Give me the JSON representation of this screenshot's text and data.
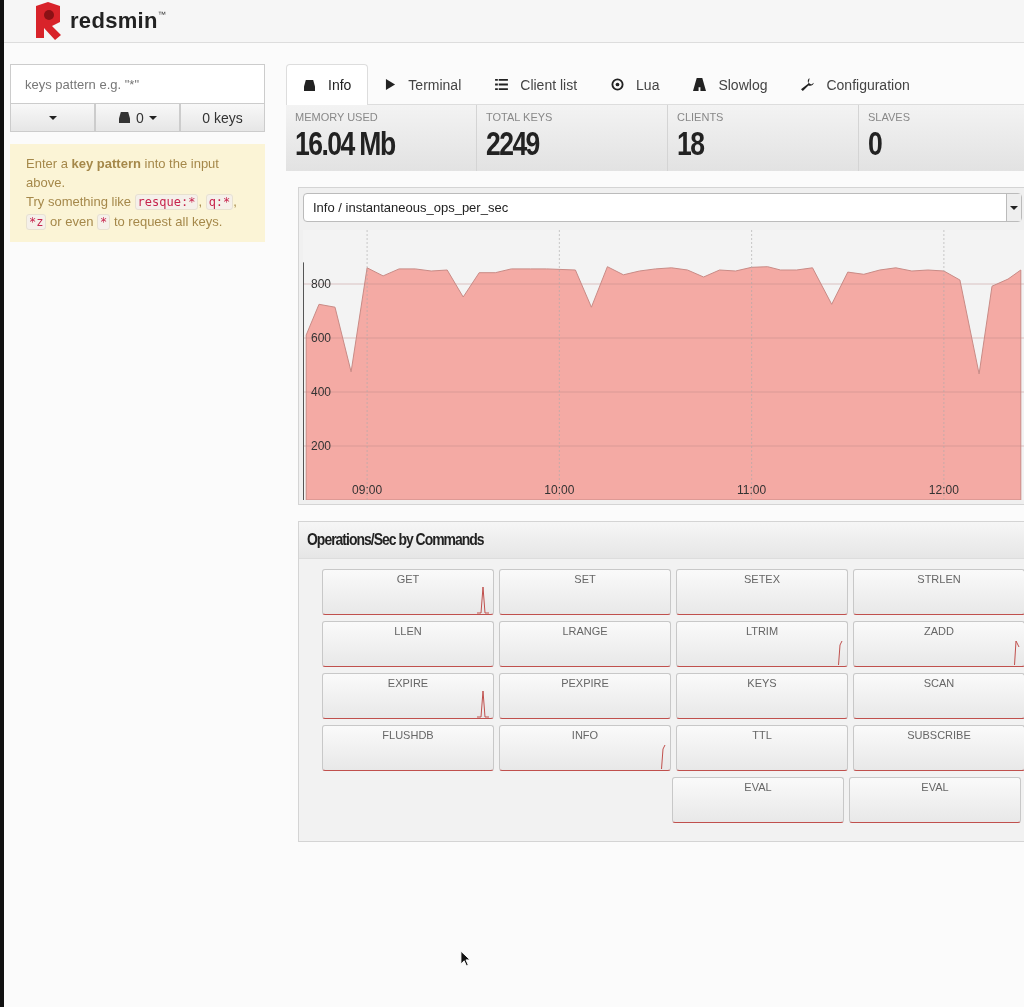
{
  "header": {
    "brand": "redsmin",
    "trademark": "™"
  },
  "sidebar": {
    "search": {
      "placeholder": "keys pattern e.g. \"*\""
    },
    "db_button": "0",
    "keys_count": "0 keys",
    "hint": {
      "intro": "Enter a **key pattern** into the input above.",
      "parts": [
        {
          "kind": "text",
          "text": "Try something like "
        },
        {
          "kind": "code",
          "text": "resque:*"
        },
        {
          "kind": "text",
          "text": ", "
        },
        {
          "kind": "code",
          "text": "q:*"
        },
        {
          "kind": "text",
          "text": ", "
        },
        {
          "kind": "code",
          "text": "*z"
        },
        {
          "kind": "text",
          "text": " or even "
        },
        {
          "kind": "code",
          "text": "*"
        },
        {
          "kind": "text",
          "text": " to request all keys."
        }
      ]
    }
  },
  "tabs": [
    {
      "label": "Info",
      "selected": true
    },
    {
      "label": "Terminal",
      "selected": false
    },
    {
      "label": "Client list",
      "selected": false
    },
    {
      "label": "Lua",
      "selected": false
    },
    {
      "label": "Slowlog",
      "selected": false
    },
    {
      "label": "Configuration",
      "selected": false
    }
  ],
  "stats": [
    {
      "label": "MEMORY USED",
      "value": "16.04 Mb"
    },
    {
      "label": "TOTAL KEYS",
      "value": "2249"
    },
    {
      "label": "CLIENTS",
      "value": "18"
    },
    {
      "label": "SLAVES",
      "value": "0"
    }
  ],
  "metric_select": {
    "value": "Info / instantaneous_ops_per_sec"
  },
  "chart_data": {
    "type": "area",
    "x": [
      521,
      525,
      530,
      535,
      540,
      545,
      550,
      555,
      560,
      565,
      570,
      575,
      580,
      585,
      591,
      596,
      605,
      610,
      615,
      620,
      625,
      630,
      635,
      640,
      645,
      650,
      655,
      660,
      665,
      669,
      674,
      679,
      685,
      690,
      695,
      700,
      705,
      710,
      715,
      720,
      725,
      731,
      735,
      740,
      744
    ],
    "grid": true,
    "series": [
      {
        "color": "#f4aaa4",
        "values": [
          611,
          725,
          714,
          475,
          860,
          830,
          856,
          856,
          848,
          852,
          752,
          842,
          842,
          856,
          856,
          856,
          852,
          714,
          864,
          834,
          848,
          856,
          860,
          852,
          826,
          852,
          848,
          862,
          864,
          852,
          852,
          860,
          725,
          844,
          836,
          852,
          860,
          848,
          852,
          848,
          815,
          467,
          792,
          818,
          852
        ]
      }
    ],
    "xlim": [
      520,
      745
    ],
    "ylim": [
      0,
      1000
    ],
    "xticks": [
      {
        "value": 540,
        "label": "09:00"
      },
      {
        "value": 600,
        "label": "10:00"
      },
      {
        "value": 660,
        "label": "11:00"
      },
      {
        "value": 720,
        "label": "12:00"
      }
    ],
    "yticks": [
      200,
      400,
      600,
      800
    ]
  },
  "commands": {
    "title": "Operations/Sec by Commands",
    "buttons": [
      {
        "label": "GET"
      },
      {
        "label": "SET"
      },
      {
        "label": "SETEX"
      },
      {
        "label": "STRLEN"
      },
      {
        "label": "LLEN"
      },
      {
        "label": "LRANGE"
      },
      {
        "label": "LTRIM"
      },
      {
        "label": "ZADD"
      },
      {
        "label": "EXPIRE"
      },
      {
        "label": "PEXPIRE"
      },
      {
        "label": "KEYS"
      },
      {
        "label": "SCAN"
      },
      {
        "label": "FLUSHDB"
      },
      {
        "label": "INFO"
      },
      {
        "label": "TTL"
      },
      {
        "label": "SUBSCRIBE"
      },
      {
        "label": "EVAL"
      },
      {
        "label": "EVAL"
      }
    ]
  }
}
